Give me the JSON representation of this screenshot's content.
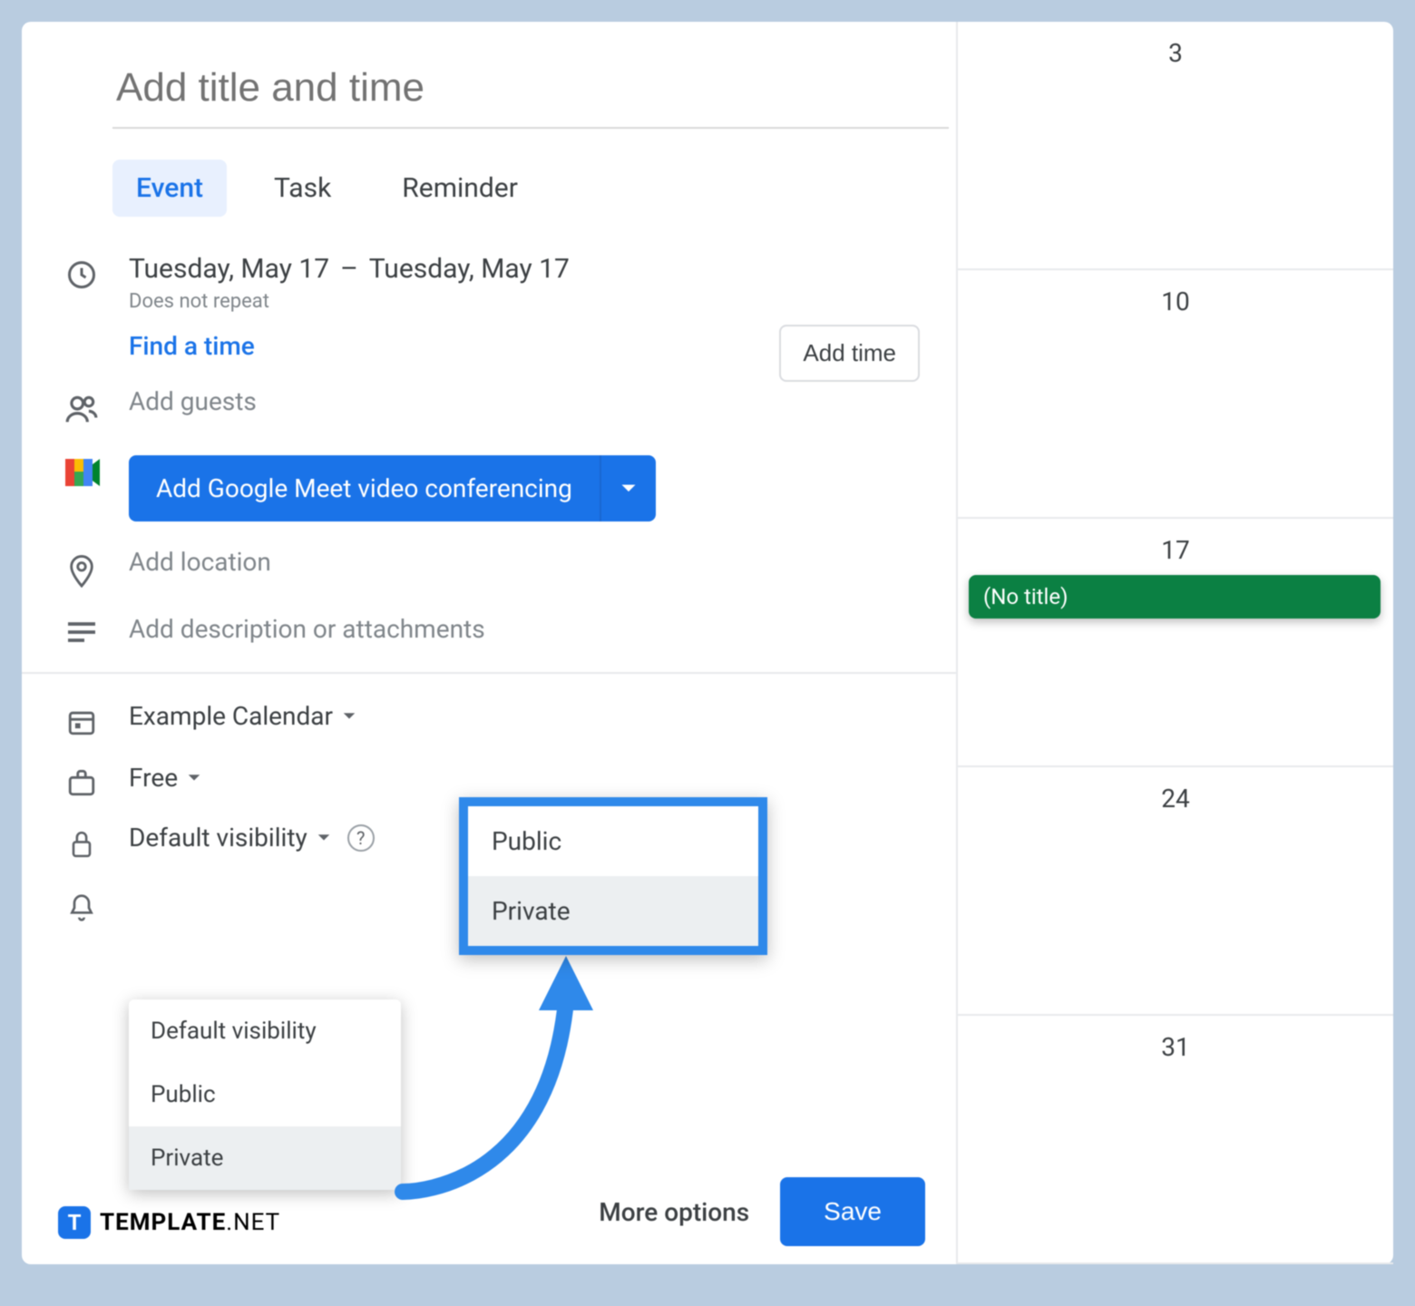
{
  "title_placeholder": "Add title and time",
  "tabs": {
    "event": "Event",
    "task": "Task",
    "reminder": "Reminder"
  },
  "date": {
    "start": "Tuesday, May 17",
    "dash": "–",
    "end": "Tuesday, May 17",
    "repeat": "Does not repeat",
    "add_time": "Add time",
    "find_time": "Find a time"
  },
  "guests": "Add guests",
  "meet": "Add Google Meet video conferencing",
  "location": "Add location",
  "description": "Add description or attachments",
  "calendar_select": "Example Calendar",
  "availability": "Free",
  "visibility_label": "Default visibility",
  "visibility_dropdown": {
    "default": "Default visibility",
    "public": "Public",
    "private": "Private"
  },
  "highlight": {
    "public": "Public",
    "private": "Private"
  },
  "footer": {
    "more": "More options",
    "save": "Save"
  },
  "calendar": {
    "d1": "3",
    "d2": "10",
    "d3": "17",
    "d4": "24",
    "d5": "31",
    "event": "(No title)"
  },
  "watermark": {
    "icon_letter": "T",
    "bold": "TEMPLATE",
    "rest": ".NET"
  }
}
